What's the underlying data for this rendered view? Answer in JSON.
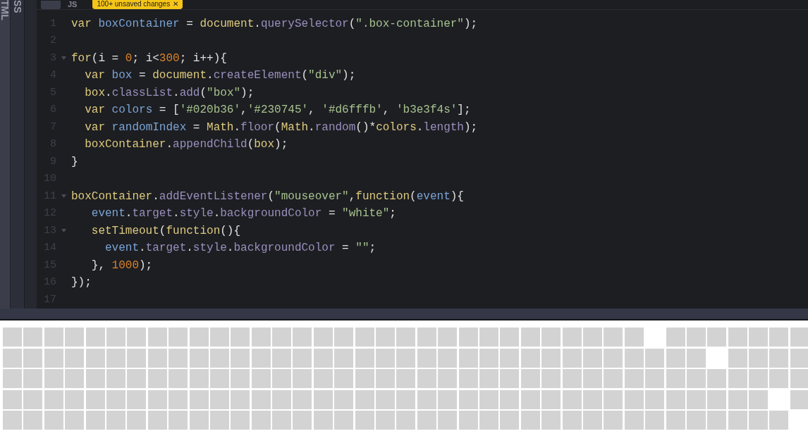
{
  "side_tabs": [
    {
      "label": "TML"
    },
    {
      "label": "SS"
    }
  ],
  "editor": {
    "tab": "JS",
    "badge": {
      "text": "100+ unsaved changes",
      "close": "✕"
    },
    "lines": [
      {
        "number": "1",
        "foldable": false,
        "tokens": [
          {
            "kind": "kw",
            "text": "var"
          },
          {
            "kind": "var",
            "text": " boxContainer"
          },
          {
            "kind": "p",
            "text": " = "
          },
          {
            "kind": "kw",
            "text": "document"
          },
          {
            "kind": "p",
            "text": "."
          },
          {
            "kind": "prop",
            "text": "querySelector"
          },
          {
            "kind": "p",
            "text": "("
          },
          {
            "kind": "str",
            "text": "\".box-container\""
          },
          {
            "kind": "p",
            "text": ");"
          }
        ]
      },
      {
        "number": "2",
        "foldable": false
      },
      {
        "number": "3",
        "foldable": true,
        "tokens": [
          {
            "kind": "kw",
            "text": "for"
          },
          {
            "kind": "p",
            "text": "(i = "
          },
          {
            "kind": "num",
            "text": "0"
          },
          {
            "kind": "p",
            "text": "; i<"
          },
          {
            "kind": "num",
            "text": "300"
          },
          {
            "kind": "p",
            "text": "; i++){"
          }
        ]
      },
      {
        "number": "4",
        "foldable": false,
        "tokens": [
          {
            "kind": "kw",
            "text": "  var"
          },
          {
            "kind": "var",
            "text": " box"
          },
          {
            "kind": "p",
            "text": " = "
          },
          {
            "kind": "kw",
            "text": "document"
          },
          {
            "kind": "p",
            "text": "."
          },
          {
            "kind": "prop",
            "text": "createElement"
          },
          {
            "kind": "p",
            "text": "("
          },
          {
            "kind": "str",
            "text": "\"div\""
          },
          {
            "kind": "p",
            "text": ");"
          }
        ]
      },
      {
        "number": "5",
        "foldable": false,
        "tokens": [
          {
            "kind": "kw",
            "text": "  box"
          },
          {
            "kind": "p",
            "text": "."
          },
          {
            "kind": "prop",
            "text": "classList"
          },
          {
            "kind": "p",
            "text": "."
          },
          {
            "kind": "prop",
            "text": "add"
          },
          {
            "kind": "p",
            "text": "("
          },
          {
            "kind": "str",
            "text": "\"box\""
          },
          {
            "kind": "p",
            "text": ");"
          }
        ]
      },
      {
        "number": "6",
        "foldable": false,
        "tokens": [
          {
            "kind": "kw",
            "text": "  var"
          },
          {
            "kind": "var",
            "text": " colors"
          },
          {
            "kind": "p",
            "text": " = ["
          },
          {
            "kind": "str",
            "text": "'#020b36'"
          },
          {
            "kind": "p",
            "text": ","
          },
          {
            "kind": "str",
            "text": "'#230745'"
          },
          {
            "kind": "p",
            "text": ","
          },
          {
            "kind": "str",
            "text": " '#d6fffb'"
          },
          {
            "kind": "p",
            "text": ","
          },
          {
            "kind": "str",
            "text": " 'b3e3f4s'"
          },
          {
            "kind": "p",
            "text": "];"
          }
        ]
      },
      {
        "number": "7",
        "foldable": false,
        "tokens": [
          {
            "kind": "kw",
            "text": "  var"
          },
          {
            "kind": "var",
            "text": " randomIndex"
          },
          {
            "kind": "p",
            "text": " = "
          },
          {
            "kind": "kw",
            "text": "Math"
          },
          {
            "kind": "p",
            "text": "."
          },
          {
            "kind": "prop",
            "text": "floor"
          },
          {
            "kind": "p",
            "text": "("
          },
          {
            "kind": "kw",
            "text": "Math"
          },
          {
            "kind": "p",
            "text": "."
          },
          {
            "kind": "prop",
            "text": "random"
          },
          {
            "kind": "p",
            "text": "()*"
          },
          {
            "kind": "kw",
            "text": "colors"
          },
          {
            "kind": "p",
            "text": "."
          },
          {
            "kind": "prop",
            "text": "length"
          },
          {
            "kind": "p",
            "text": ");"
          }
        ]
      },
      {
        "number": "8",
        "foldable": false,
        "tokens": [
          {
            "kind": "kw",
            "text": "  boxContainer"
          },
          {
            "kind": "p",
            "text": "."
          },
          {
            "kind": "prop",
            "text": "appendChild"
          },
          {
            "kind": "p",
            "text": "("
          },
          {
            "kind": "kw",
            "text": "box"
          },
          {
            "kind": "p",
            "text": ");"
          }
        ]
      },
      {
        "number": "9",
        "foldable": false,
        "tokens": [
          {
            "kind": "p",
            "text": "}"
          }
        ]
      },
      {
        "number": "10",
        "foldable": false
      },
      {
        "number": "11",
        "foldable": true,
        "tokens": [
          {
            "kind": "kw",
            "text": "boxContainer"
          },
          {
            "kind": "p",
            "text": "."
          },
          {
            "kind": "prop",
            "text": "addEventListener"
          },
          {
            "kind": "p",
            "text": "("
          },
          {
            "kind": "str",
            "text": "\"mouseover\""
          },
          {
            "kind": "p",
            "text": ","
          },
          {
            "kind": "kw",
            "text": "function"
          },
          {
            "kind": "p",
            "text": "("
          },
          {
            "kind": "var",
            "text": "event"
          },
          {
            "kind": "p",
            "text": "){"
          }
        ]
      },
      {
        "number": "12",
        "foldable": false,
        "tokens": [
          {
            "kind": "var",
            "text": "   event"
          },
          {
            "kind": "p",
            "text": "."
          },
          {
            "kind": "prop",
            "text": "target"
          },
          {
            "kind": "p",
            "text": "."
          },
          {
            "kind": "prop",
            "text": "style"
          },
          {
            "kind": "p",
            "text": "."
          },
          {
            "kind": "prop",
            "text": "backgroundColor"
          },
          {
            "kind": "p",
            "text": " = "
          },
          {
            "kind": "str",
            "text": "\"white\""
          },
          {
            "kind": "p",
            "text": ";"
          }
        ]
      },
      {
        "number": "13",
        "foldable": true,
        "tokens": [
          {
            "kind": "kw",
            "text": "   setTimeout"
          },
          {
            "kind": "p",
            "text": "("
          },
          {
            "kind": "kw",
            "text": "function"
          },
          {
            "kind": "p",
            "text": "(){"
          }
        ]
      },
      {
        "number": "14",
        "foldable": false,
        "tokens": [
          {
            "kind": "var",
            "text": "     event"
          },
          {
            "kind": "p",
            "text": "."
          },
          {
            "kind": "prop",
            "text": "target"
          },
          {
            "kind": "p",
            "text": "."
          },
          {
            "kind": "prop",
            "text": "style"
          },
          {
            "kind": "p",
            "text": "."
          },
          {
            "kind": "prop",
            "text": "backgroundColor"
          },
          {
            "kind": "p",
            "text": " = "
          },
          {
            "kind": "str",
            "text": "\"\""
          },
          {
            "kind": "p",
            "text": ";"
          }
        ]
      },
      {
        "number": "15",
        "foldable": false,
        "tokens": [
          {
            "kind": "p",
            "text": "   }, "
          },
          {
            "kind": "num",
            "text": "1000"
          },
          {
            "kind": "p",
            "text": ");"
          }
        ]
      },
      {
        "number": "16",
        "foldable": false,
        "tokens": [
          {
            "kind": "p",
            "text": "});"
          }
        ]
      },
      {
        "number": "17",
        "foldable": false
      }
    ]
  },
  "box_grid": {
    "rows": [
      {
        "cells": [
          {
            "highlighted": false
          },
          {
            "highlighted": false
          },
          {
            "highlighted": false
          },
          {
            "highlighted": false
          },
          {
            "highlighted": false
          },
          {
            "highlighted": false
          },
          {
            "highlighted": false
          },
          {
            "highlighted": false
          },
          {
            "highlighted": false
          },
          {
            "highlighted": false
          },
          {
            "highlighted": false
          },
          {
            "highlighted": false
          },
          {
            "highlighted": false
          },
          {
            "highlighted": false
          },
          {
            "highlighted": false
          },
          {
            "highlighted": false
          },
          {
            "highlighted": false
          },
          {
            "highlighted": false
          },
          {
            "highlighted": false
          },
          {
            "highlighted": false
          },
          {
            "highlighted": false
          },
          {
            "highlighted": false
          },
          {
            "highlighted": false
          },
          {
            "highlighted": false
          },
          {
            "highlighted": false
          },
          {
            "highlighted": false
          },
          {
            "highlighted": false
          },
          {
            "highlighted": false
          },
          {
            "highlighted": false
          },
          {
            "highlighted": false
          },
          {
            "highlighted": false
          },
          {
            "highlighted": true
          },
          {
            "highlighted": false
          },
          {
            "highlighted": false
          },
          {
            "highlighted": false
          },
          {
            "highlighted": false
          },
          {
            "highlighted": false
          },
          {
            "highlighted": false
          },
          {
            "highlighted": false
          }
        ]
      },
      {
        "cells": [
          {
            "highlighted": false
          },
          {
            "highlighted": false
          },
          {
            "highlighted": false
          },
          {
            "highlighted": false
          },
          {
            "highlighted": false
          },
          {
            "highlighted": false
          },
          {
            "highlighted": false
          },
          {
            "highlighted": false
          },
          {
            "highlighted": false
          },
          {
            "highlighted": false
          },
          {
            "highlighted": false
          },
          {
            "highlighted": false
          },
          {
            "highlighted": false
          },
          {
            "highlighted": false
          },
          {
            "highlighted": false
          },
          {
            "highlighted": false
          },
          {
            "highlighted": false
          },
          {
            "highlighted": false
          },
          {
            "highlighted": false
          },
          {
            "highlighted": false
          },
          {
            "highlighted": false
          },
          {
            "highlighted": false
          },
          {
            "highlighted": false
          },
          {
            "highlighted": false
          },
          {
            "highlighted": false
          },
          {
            "highlighted": false
          },
          {
            "highlighted": false
          },
          {
            "highlighted": false
          },
          {
            "highlighted": false
          },
          {
            "highlighted": false
          },
          {
            "highlighted": false
          },
          {
            "highlighted": false
          },
          {
            "highlighted": false
          },
          {
            "highlighted": false
          },
          {
            "highlighted": true
          },
          {
            "highlighted": false
          },
          {
            "highlighted": false
          },
          {
            "highlighted": false
          },
          {
            "highlighted": false
          }
        ]
      },
      {
        "cells": [
          {
            "highlighted": false
          },
          {
            "highlighted": false
          },
          {
            "highlighted": false
          },
          {
            "highlighted": false
          },
          {
            "highlighted": false
          },
          {
            "highlighted": false
          },
          {
            "highlighted": false
          },
          {
            "highlighted": false
          },
          {
            "highlighted": false
          },
          {
            "highlighted": false
          },
          {
            "highlighted": false
          },
          {
            "highlighted": false
          },
          {
            "highlighted": false
          },
          {
            "highlighted": false
          },
          {
            "highlighted": false
          },
          {
            "highlighted": false
          },
          {
            "highlighted": false
          },
          {
            "highlighted": false
          },
          {
            "highlighted": false
          },
          {
            "highlighted": false
          },
          {
            "highlighted": false
          },
          {
            "highlighted": false
          },
          {
            "highlighted": false
          },
          {
            "highlighted": false
          },
          {
            "highlighted": false
          },
          {
            "highlighted": false
          },
          {
            "highlighted": false
          },
          {
            "highlighted": false
          },
          {
            "highlighted": false
          },
          {
            "highlighted": false
          },
          {
            "highlighted": false
          },
          {
            "highlighted": false
          },
          {
            "highlighted": false
          },
          {
            "highlighted": false
          },
          {
            "highlighted": false
          },
          {
            "highlighted": false
          },
          {
            "highlighted": false
          },
          {
            "highlighted": false
          },
          {
            "highlighted": false
          }
        ]
      },
      {
        "cells": [
          {
            "highlighted": false
          },
          {
            "highlighted": false
          },
          {
            "highlighted": false
          },
          {
            "highlighted": false
          },
          {
            "highlighted": false
          },
          {
            "highlighted": false
          },
          {
            "highlighted": false
          },
          {
            "highlighted": false
          },
          {
            "highlighted": false
          },
          {
            "highlighted": false
          },
          {
            "highlighted": false
          },
          {
            "highlighted": false
          },
          {
            "highlighted": false
          },
          {
            "highlighted": false
          },
          {
            "highlighted": false
          },
          {
            "highlighted": false
          },
          {
            "highlighted": false
          },
          {
            "highlighted": false
          },
          {
            "highlighted": false
          },
          {
            "highlighted": false
          },
          {
            "highlighted": false
          },
          {
            "highlighted": false
          },
          {
            "highlighted": false
          },
          {
            "highlighted": false
          },
          {
            "highlighted": false
          },
          {
            "highlighted": false
          },
          {
            "highlighted": false
          },
          {
            "highlighted": false
          },
          {
            "highlighted": false
          },
          {
            "highlighted": false
          },
          {
            "highlighted": false
          },
          {
            "highlighted": false
          },
          {
            "highlighted": false
          },
          {
            "highlighted": false
          },
          {
            "highlighted": false
          },
          {
            "highlighted": false
          },
          {
            "highlighted": false
          },
          {
            "highlighted": true
          },
          {
            "highlighted": false
          }
        ]
      },
      {
        "cells": [
          {
            "highlighted": false
          },
          {
            "highlighted": false
          },
          {
            "highlighted": false
          },
          {
            "highlighted": false
          },
          {
            "highlighted": false
          },
          {
            "highlighted": false
          },
          {
            "highlighted": false
          },
          {
            "highlighted": false
          },
          {
            "highlighted": false
          },
          {
            "highlighted": false
          },
          {
            "highlighted": false
          },
          {
            "highlighted": false
          },
          {
            "highlighted": false
          },
          {
            "highlighted": false
          },
          {
            "highlighted": false
          },
          {
            "highlighted": false
          },
          {
            "highlighted": false
          },
          {
            "highlighted": false
          },
          {
            "highlighted": false
          },
          {
            "highlighted": false
          },
          {
            "highlighted": false
          },
          {
            "highlighted": false
          },
          {
            "highlighted": false
          },
          {
            "highlighted": false
          },
          {
            "highlighted": false
          },
          {
            "highlighted": false
          },
          {
            "highlighted": false
          },
          {
            "highlighted": false
          },
          {
            "highlighted": false
          },
          {
            "highlighted": false
          },
          {
            "highlighted": false
          },
          {
            "highlighted": false
          },
          {
            "highlighted": false
          },
          {
            "highlighted": false
          },
          {
            "highlighted": false
          },
          {
            "highlighted": false
          },
          {
            "highlighted": false
          },
          {
            "highlighted": false
          },
          {
            "highlighted": true
          }
        ]
      }
    ]
  }
}
